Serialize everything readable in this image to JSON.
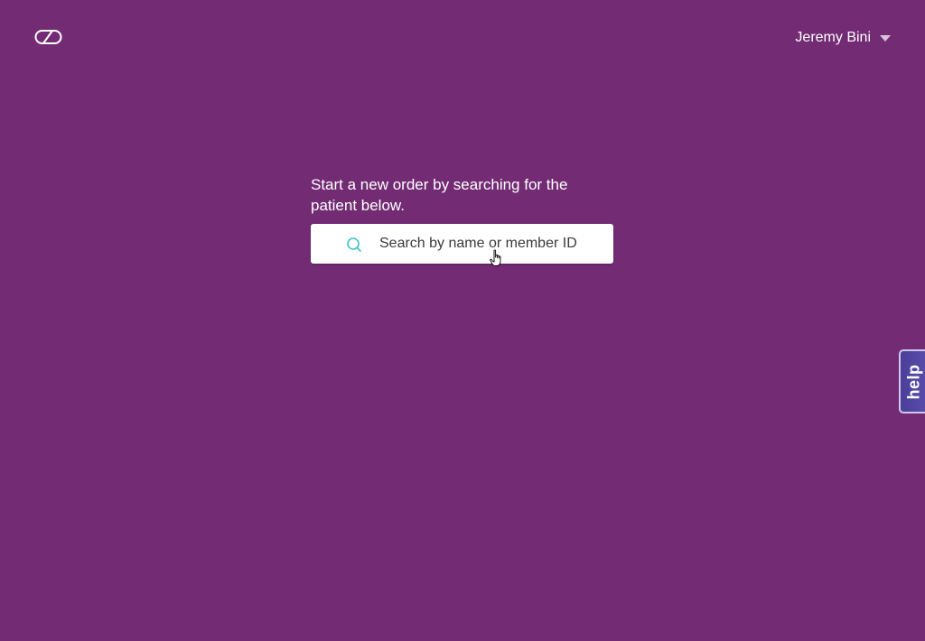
{
  "header": {
    "logo_icon": "zipnosis-logo-icon",
    "user_name": "Jeremy Bini",
    "user_menu_icon": "caret-down-icon"
  },
  "main": {
    "prompt": "Start a new order by searching for the patient below.",
    "search": {
      "placeholder": "Search by name or member ID",
      "value": "",
      "icon": "search-icon",
      "icon_color": "#3fc1c9"
    }
  },
  "help_tab": {
    "label": "help"
  },
  "colors": {
    "background": "#732c74",
    "help_tab": "#54469f"
  }
}
